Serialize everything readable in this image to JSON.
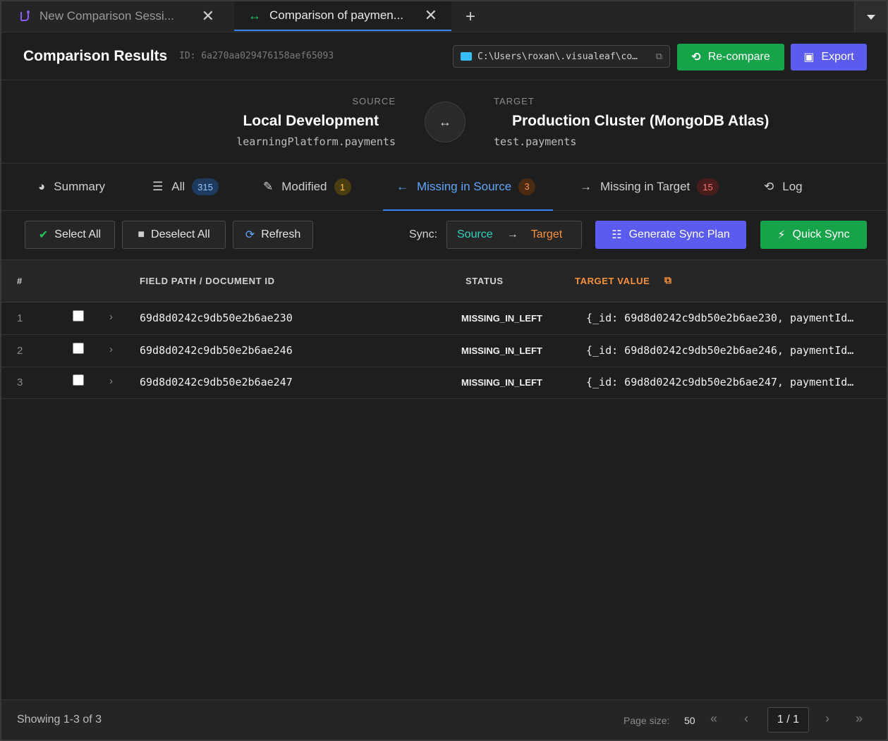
{
  "window_tabs": [
    {
      "label": "New Comparison Sessi...",
      "icon": "merge-icon"
    },
    {
      "label": "Comparison of paymen...",
      "icon": "arrows-horizontal-icon"
    }
  ],
  "header": {
    "title": "Comparison Results",
    "id_text": "ID: 6a270aa029476158aef65093",
    "path": "C:\\Users\\roxan\\.visualeaf\\co…",
    "recompare_label": "Re-compare",
    "export_label": "Export"
  },
  "source": {
    "caption": "SOURCE",
    "name": "Local Development",
    "namespace": "learningPlatform.payments"
  },
  "target": {
    "caption": "TARGET",
    "name": "Production Cluster (MongoDB Atlas)",
    "namespace": "test.payments"
  },
  "result_tabs": [
    {
      "label": "Summary",
      "badge": null
    },
    {
      "label": "All",
      "badge": "315"
    },
    {
      "label": "Modified",
      "badge": "1"
    },
    {
      "label": "Missing in Source",
      "badge": "3"
    },
    {
      "label": "Missing in Target",
      "badge": "15"
    },
    {
      "label": "Log",
      "badge": null
    }
  ],
  "toolbar": {
    "select_all": "Select All",
    "deselect_all": "Deselect All",
    "refresh": "Refresh",
    "sync_label": "Sync:",
    "sync_source": "Source",
    "sync_arrow": "→",
    "sync_target": "Target",
    "generate_plan": "Generate Sync Plan",
    "quick_sync": "Quick Sync"
  },
  "table": {
    "headers": {
      "num": "#",
      "path": "FIELD PATH / DOCUMENT ID",
      "status": "STATUS",
      "target_value": "TARGET VALUE"
    },
    "rows": [
      {
        "num": "1",
        "id": "69d8d0242c9db50e2b6ae230",
        "status": "MISSING_IN_LEFT",
        "value": "{_id: 69d8d0242c9db50e2b6ae230, paymentId…"
      },
      {
        "num": "2",
        "id": "69d8d0242c9db50e2b6ae246",
        "status": "MISSING_IN_LEFT",
        "value": "{_id: 69d8d0242c9db50e2b6ae246, paymentId…"
      },
      {
        "num": "3",
        "id": "69d8d0242c9db50e2b6ae247",
        "status": "MISSING_IN_LEFT",
        "value": "{_id: 69d8d0242c9db50e2b6ae247, paymentId…"
      }
    ]
  },
  "footer": {
    "showing": "Showing 1-3 of 3",
    "page_size_label": "Page size:",
    "page_size": "50",
    "page": "1 / 1"
  },
  "colors": {
    "accent_blue": "#3b82f6",
    "green": "#16a34a",
    "indigo": "#5b5bf0",
    "orange": "#fb923c",
    "teal": "#2dd4bf"
  }
}
